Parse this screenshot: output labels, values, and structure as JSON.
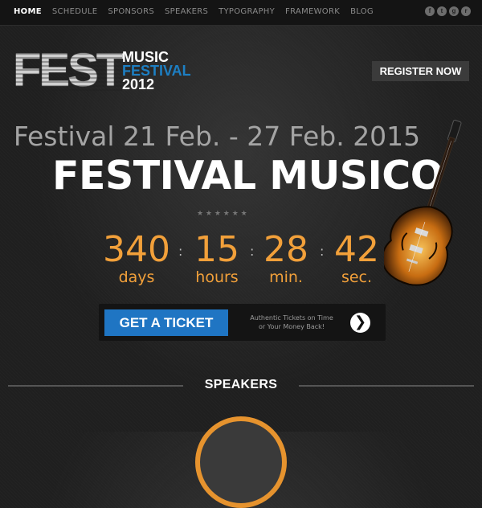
{
  "nav": {
    "items": [
      "HOME",
      "SCHEDULE",
      "SPONSORS",
      "SPEAKERS",
      "TYPOGRAPHY",
      "FRAMEWORK",
      "BLOG"
    ],
    "active": "HOME",
    "social": [
      "f",
      "t",
      "g",
      "r"
    ]
  },
  "logo": {
    "mark": "FEST",
    "line1": "MUSIC",
    "line2": "FESTIVAL",
    "line3": "2012"
  },
  "register_label": "REGISTER NOW",
  "hero": {
    "dates": "Festival 21 Feb. - 27 Feb. 2015",
    "title": "FESTIVAL MUSICO",
    "stars": "★ ★ ★ ★ ★ ★"
  },
  "countdown": {
    "days": "340",
    "days_label": "days",
    "hours": "15",
    "hours_label": "hours",
    "minutes": "28",
    "minutes_label": "min.",
    "seconds": "42",
    "seconds_label": "sec.",
    "separator": ":"
  },
  "ticket": {
    "button": "GET A TICKET",
    "note": "Authentic Tickets on Time or Your Money Back!",
    "arrow": "❯"
  },
  "speakers_title": "SPEAKERS",
  "colors": {
    "accent": "#f2a03a",
    "blue": "#1f75c3"
  },
  "icons": [
    "facebook-icon",
    "twitter-icon",
    "google-icon",
    "rss-icon",
    "guitar-image",
    "chevron-right-icon"
  ]
}
